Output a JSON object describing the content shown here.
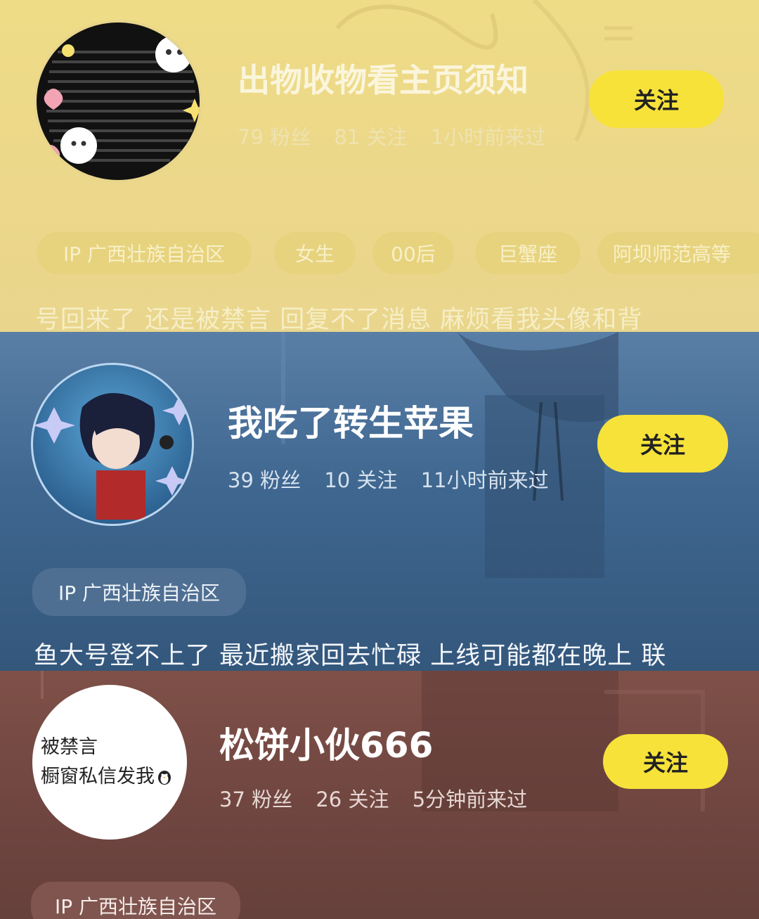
{
  "cards": [
    {
      "name": "出物收物看主页须知",
      "stats": {
        "fans": "79 粉丝",
        "following": "81 关注",
        "last_seen": "1小时前来过"
      },
      "follow_label": "关注",
      "tags": [
        "IP 广西壮族自治区",
        "女生",
        "00后",
        "巨蟹座",
        "阿坝师范高等"
      ],
      "bio": "号回来了 还是被禁言 回复不了消息 麻烦看我头像和背",
      "accent": "#f7e23a"
    },
    {
      "name": "我吃了转生苹果",
      "stats": {
        "fans": "39 粉丝",
        "following": "10 关注",
        "last_seen": "11小时前来过"
      },
      "follow_label": "关注",
      "tags": [
        "IP 广西壮族自治区"
      ],
      "bio": "鱼大号登不上了 最近搬家回去忙碌 上线可能都在晚上 联"
    },
    {
      "name": "松饼小伙666",
      "avatar_text": {
        "line1": "被禁言",
        "line2": "橱窗私信发我"
      },
      "stats": {
        "fans": "37 粉丝",
        "following": "26 关注",
        "last_seen": "5分钟前来过"
      },
      "follow_label": "关注",
      "tags": [
        "IP 广西壮族自治区"
      ]
    }
  ]
}
